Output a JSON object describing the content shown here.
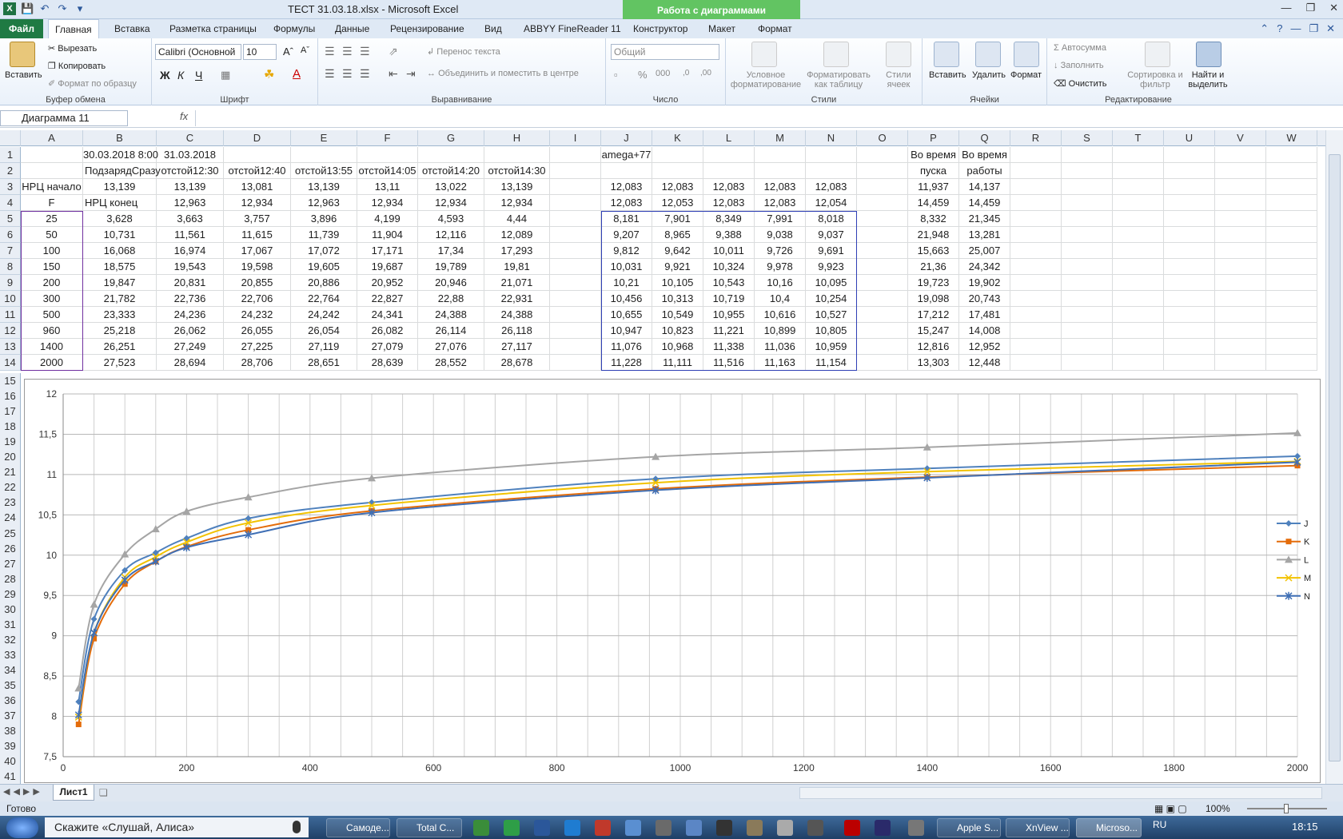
{
  "window": {
    "title": "ТЕСТ 31.03.18.xlsx  -  Microsoft Excel",
    "chart_tools": "Работа с диаграммами"
  },
  "tabs": [
    "Файл",
    "Главная",
    "Вставка",
    "Разметка страницы",
    "Формулы",
    "Данные",
    "Рецензирование",
    "Вид",
    "ABBYY FineReader 11",
    "Конструктор",
    "Макет",
    "Формат"
  ],
  "ribbon": {
    "clipboard": {
      "paste": "Вставить",
      "cut": "Вырезать",
      "copy": "Копировать",
      "format_painter": "Формат по образцу",
      "label": "Буфер обмена"
    },
    "font": {
      "name": "Calibri (Основной",
      "size": "10",
      "bold": "Ж",
      "italic": "К",
      "underline": "Ч",
      "label": "Шрифт"
    },
    "alignment": {
      "wrap": "Перенос текста",
      "merge": "Объединить и поместить в центре",
      "label": "Выравнивание"
    },
    "number": {
      "format": "Общий",
      "label": "Число"
    },
    "styles": {
      "conditional": "Условное форматирование",
      "as_table": "Форматировать как таблицу",
      "cell_styles": "Стили ячеек",
      "label": "Стили"
    },
    "cells": {
      "insert": "Вставить",
      "delete": "Удалить",
      "format": "Формат",
      "label": "Ячейки"
    },
    "editing": {
      "autosum": "Автосумма",
      "fill": "Заполнить",
      "clear": "Очистить",
      "sort": "Сортировка и фильтр",
      "find": "Найти и выделить",
      "label": "Редактирование"
    }
  },
  "formula_bar": {
    "name_box": "Диаграмма 11",
    "fx": "fx",
    "formula": ""
  },
  "columns": [
    "A",
    "B",
    "C",
    "D",
    "E",
    "F",
    "G",
    "H",
    "I",
    "J",
    "K",
    "L",
    "M",
    "N",
    "O",
    "P",
    "Q",
    "R",
    "S",
    "T",
    "U",
    "V",
    "W"
  ],
  "rows": [
    {
      "n": "1",
      "cells": [
        "",
        "30.03.2018 8:00",
        "31.03.2018",
        "",
        "",
        "",
        "",
        "",
        "",
        "amega+77",
        "",
        "",
        "",
        "",
        "",
        "Во время",
        "Во время"
      ]
    },
    {
      "n": "2",
      "cells": [
        "",
        "ПодзарядСразу",
        "отстой12:30",
        "отстой12:40",
        "отстой13:55",
        "отстой14:05",
        "отстой14:20",
        "отстой14:30",
        "",
        "",
        "",
        "",
        "",
        "",
        "",
        "пуска",
        "работы"
      ]
    },
    {
      "n": "3",
      "cells": [
        "НРЦ начало",
        "13,139",
        "13,139",
        "13,081",
        "13,139",
        "13,11",
        "13,022",
        "13,139",
        "",
        "12,083",
        "12,083",
        "12,083",
        "12,083",
        "12,083",
        "",
        "11,937",
        "14,137"
      ]
    },
    {
      "n": "4",
      "cells": [
        "F",
        "НРЦ конец",
        "12,963",
        "12,934",
        "12,963",
        "12,934",
        "12,934",
        "12,934",
        "",
        "12,083",
        "12,053",
        "12,083",
        "12,083",
        "12,054",
        "",
        "14,459",
        "14,459"
      ]
    },
    {
      "n": "5",
      "cells": [
        "25",
        "3,628",
        "3,663",
        "3,757",
        "3,896",
        "4,199",
        "4,593",
        "4,44",
        "",
        "8,181",
        "7,901",
        "8,349",
        "7,991",
        "8,018",
        "",
        "8,332",
        "21,345"
      ]
    },
    {
      "n": "6",
      "cells": [
        "50",
        "10,731",
        "11,561",
        "11,615",
        "11,739",
        "11,904",
        "12,116",
        "12,089",
        "",
        "9,207",
        "8,965",
        "9,388",
        "9,038",
        "9,037",
        "",
        "21,948",
        "13,281"
      ]
    },
    {
      "n": "7",
      "cells": [
        "100",
        "16,068",
        "16,974",
        "17,067",
        "17,072",
        "17,171",
        "17,34",
        "17,293",
        "",
        "9,812",
        "9,642",
        "10,011",
        "9,726",
        "9,691",
        "",
        "15,663",
        "25,007"
      ]
    },
    {
      "n": "8",
      "cells": [
        "150",
        "18,575",
        "19,543",
        "19,598",
        "19,605",
        "19,687",
        "19,789",
        "19,81",
        "",
        "10,031",
        "9,921",
        "10,324",
        "9,978",
        "9,923",
        "",
        "21,36",
        "24,342"
      ]
    },
    {
      "n": "9",
      "cells": [
        "200",
        "19,847",
        "20,831",
        "20,855",
        "20,886",
        "20,952",
        "20,946",
        "21,071",
        "",
        "10,21",
        "10,105",
        "10,543",
        "10,16",
        "10,095",
        "",
        "19,723",
        "19,902"
      ]
    },
    {
      "n": "10",
      "cells": [
        "300",
        "21,782",
        "22,736",
        "22,706",
        "22,764",
        "22,827",
        "22,88",
        "22,931",
        "",
        "10,456",
        "10,313",
        "10,719",
        "10,4",
        "10,254",
        "",
        "19,098",
        "20,743"
      ]
    },
    {
      "n": "11",
      "cells": [
        "500",
        "23,333",
        "24,236",
        "24,232",
        "24,242",
        "24,341",
        "24,388",
        "24,388",
        "",
        "10,655",
        "10,549",
        "10,955",
        "10,616",
        "10,527",
        "",
        "17,212",
        "17,481"
      ]
    },
    {
      "n": "12",
      "cells": [
        "960",
        "25,218",
        "26,062",
        "26,055",
        "26,054",
        "26,082",
        "26,114",
        "26,118",
        "",
        "10,947",
        "10,823",
        "11,221",
        "10,899",
        "10,805",
        "",
        "15,247",
        "14,008"
      ]
    },
    {
      "n": "13",
      "cells": [
        "1400",
        "26,251",
        "27,249",
        "27,225",
        "27,119",
        "27,079",
        "27,076",
        "27,117",
        "",
        "11,076",
        "10,968",
        "11,338",
        "11,036",
        "10,959",
        "",
        "12,816",
        "12,952"
      ]
    },
    {
      "n": "14",
      "cells": [
        "2000",
        "27,523",
        "28,694",
        "28,706",
        "28,651",
        "28,639",
        "28,552",
        "28,678",
        "",
        "11,228",
        "11,111",
        "11,516",
        "11,163",
        "11,154",
        "",
        "13,303",
        "12,448"
      ]
    }
  ],
  "lower_rows": [
    "15",
    "16",
    "17",
    "18",
    "19",
    "20",
    "21",
    "22",
    "23",
    "24",
    "25",
    "26",
    "27",
    "28",
    "29",
    "30",
    "31",
    "32",
    "33",
    "34",
    "35",
    "36",
    "37",
    "38",
    "39",
    "40",
    "41"
  ],
  "chart_data": {
    "type": "scatter",
    "x": [
      25,
      50,
      100,
      150,
      200,
      300,
      500,
      960,
      1400,
      2000
    ],
    "series": [
      {
        "name": "J",
        "color": "#4f81bd",
        "marker": "diamond",
        "values": [
          8.181,
          9.207,
          9.812,
          10.031,
          10.21,
          10.456,
          10.655,
          10.947,
          11.076,
          11.228
        ]
      },
      {
        "name": "K",
        "color": "#e46c0a",
        "marker": "square",
        "values": [
          7.901,
          8.965,
          9.642,
          9.921,
          10.105,
          10.313,
          10.549,
          10.823,
          10.968,
          11.111
        ]
      },
      {
        "name": "L",
        "color": "#a5a5a5",
        "marker": "triangle",
        "values": [
          8.349,
          9.388,
          10.011,
          10.324,
          10.543,
          10.719,
          10.955,
          11.221,
          11.338,
          11.516
        ]
      },
      {
        "name": "M",
        "color": "#f2c200",
        "marker": "x",
        "values": [
          7.991,
          9.038,
          9.726,
          9.978,
          10.16,
          10.4,
          10.616,
          10.899,
          11.036,
          11.163
        ]
      },
      {
        "name": "N",
        "color": "#3f6fb5",
        "marker": "star",
        "values": [
          8.018,
          9.037,
          9.691,
          9.923,
          10.095,
          10.254,
          10.527,
          10.805,
          10.959,
          11.154
        ]
      }
    ],
    "xlim": [
      0,
      2000
    ],
    "ylim": [
      7.5,
      12
    ],
    "x_ticks": [
      "0",
      "200",
      "400",
      "600",
      "800",
      "1000",
      "1200",
      "1400",
      "1600",
      "1800",
      "2000"
    ],
    "y_ticks": [
      "7,5",
      "8",
      "8,5",
      "9",
      "9,5",
      "10",
      "10,5",
      "11",
      "11,5",
      "12"
    ],
    "grid": true,
    "legend": "right"
  },
  "sheet_tab": "Лист1",
  "status": {
    "ready": "Готово",
    "zoom": "100%"
  },
  "taskbar": {
    "search": "Скажите «Слушай, Алиса»",
    "items": [
      "Самоде...",
      "Total C...",
      "Apple S...",
      "XnView ...",
      "Microso..."
    ],
    "lang": "RU",
    "time": "18:15"
  }
}
